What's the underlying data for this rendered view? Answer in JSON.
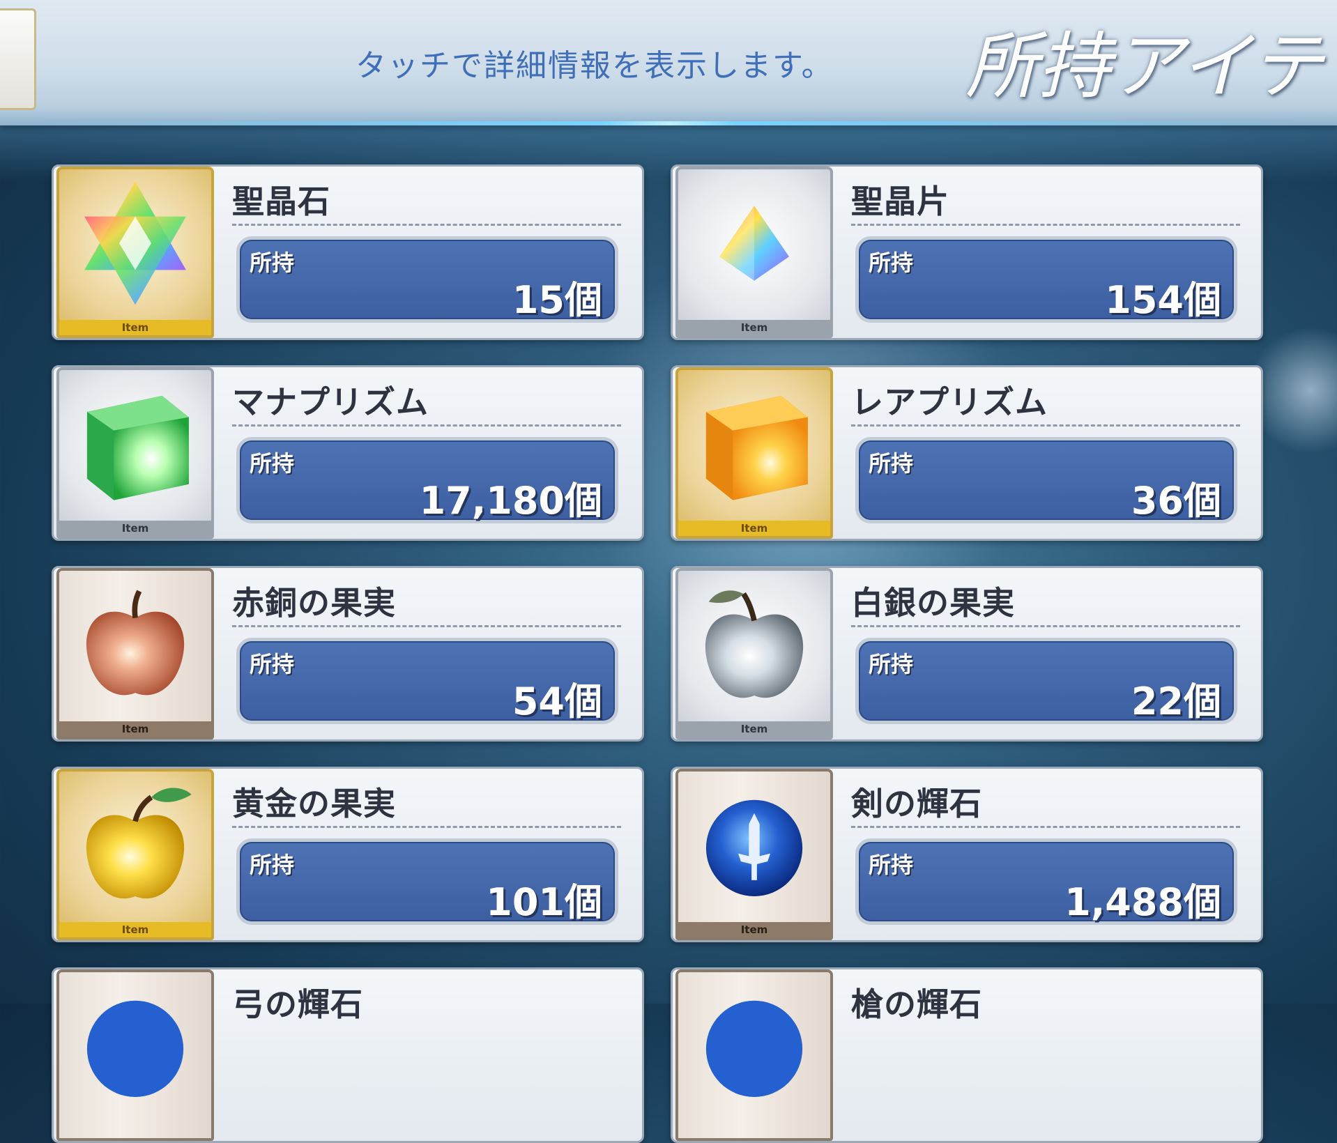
{
  "header": {
    "hint": "タッチで詳細情報を表示します。",
    "title": "所持アイテ"
  },
  "items": [
    {
      "name": "聖晶石",
      "owned_label": "所持",
      "count": "15個",
      "tag": "Item",
      "frame": "gold",
      "icon": "saint-quartz-icon"
    },
    {
      "name": "聖晶片",
      "owned_label": "所持",
      "count": "154個",
      "tag": "Item",
      "frame": "silver",
      "icon": "quartz-fragment-icon"
    },
    {
      "name": "マナプリズム",
      "owned_label": "所持",
      "count": "17,180個",
      "tag": "Item",
      "frame": "silver",
      "icon": "mana-prism-icon"
    },
    {
      "name": "レアプリズム",
      "owned_label": "所持",
      "count": "36個",
      "tag": "Item",
      "frame": "gold",
      "icon": "rare-prism-icon"
    },
    {
      "name": "赤銅の果実",
      "owned_label": "所持",
      "count": "54個",
      "tag": "Item",
      "frame": "bronze",
      "icon": "bronze-apple-icon"
    },
    {
      "name": "白銀の果実",
      "owned_label": "所持",
      "count": "22個",
      "tag": "Item",
      "frame": "silver",
      "icon": "silver-apple-icon"
    },
    {
      "name": "黄金の果実",
      "owned_label": "所持",
      "count": "101個",
      "tag": "Item",
      "frame": "gold",
      "icon": "golden-apple-icon"
    },
    {
      "name": "剣の輝石",
      "owned_label": "所持",
      "count": "1,488個",
      "tag": "Item",
      "frame": "bronze",
      "icon": "saber-gem-icon"
    },
    {
      "name": "弓の輝石",
      "owned_label": "",
      "count": "",
      "tag": "",
      "frame": "bronze",
      "icon": "archer-gem-icon"
    },
    {
      "name": "槍の輝石",
      "owned_label": "",
      "count": "",
      "tag": "",
      "frame": "bronze",
      "icon": "lancer-gem-icon"
    }
  ],
  "colors": {
    "count_box": "#4a6cb0",
    "gold_frame": "#e7bb25",
    "silver_frame": "#9aa2ac",
    "bronze_frame": "#8d7a67"
  }
}
